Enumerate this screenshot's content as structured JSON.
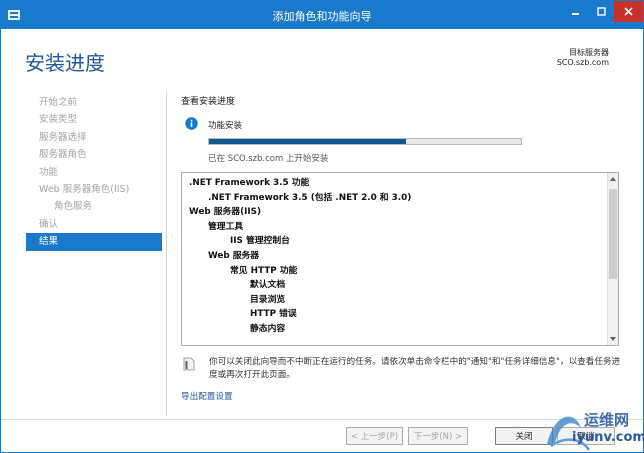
{
  "window": {
    "title": "添加角色和功能向导",
    "controls": {
      "minimize": "▬",
      "maximize": "□",
      "close": "✕"
    }
  },
  "header": {
    "page_title": "安装进度",
    "target_label": "目标服务器",
    "target_server": "SCO.szb.com"
  },
  "nav": {
    "items": [
      {
        "label": "开始之前"
      },
      {
        "label": "安装类型"
      },
      {
        "label": "服务器选择"
      },
      {
        "label": "服务器角色"
      },
      {
        "label": "功能"
      },
      {
        "label": "Web 服务器角色(IIS)"
      },
      {
        "label": "角色服务"
      },
      {
        "label": "确认"
      },
      {
        "label": "结果"
      }
    ],
    "active_index": 8
  },
  "main": {
    "section_label": "查看安装进度",
    "feature_install_label": "功能安装",
    "progress": 0.63,
    "status": "已在 SCO.szb.com 上开始安装",
    "list": [
      {
        "text": ".NET Framework 3.5 功能",
        "level": 0
      },
      {
        "text": ".NET Framework 3.5 (包括 .NET 2.0 和 3.0)",
        "level": 1
      },
      {
        "text": "Web 服务器(IIS)",
        "level": 0
      },
      {
        "text": "管理工具",
        "level": 1
      },
      {
        "text": "IIS 管理控制台",
        "level": 2
      },
      {
        "text": "Web 服务器",
        "level": 1
      },
      {
        "text": "常见 HTTP 功能",
        "level": 2
      },
      {
        "text": "默认文档",
        "level": 3
      },
      {
        "text": "目录浏览",
        "level": 3
      },
      {
        "text": "HTTP 错误",
        "level": 3
      },
      {
        "text": "静态内容",
        "level": 3
      }
    ],
    "note": "你可以关闭此向导而不中断正在运行的任务。请依次单击命令栏中的\"通知\"和\"任务详细信息\"，以查看任务进度或再次打开此页面。",
    "export_link": "导出配置设置"
  },
  "footer": {
    "prev": "< 上一步(P)",
    "next": "下一步(N) >",
    "close": "关闭",
    "cancel": "取消"
  },
  "watermark": {
    "line1": "运维网",
    "line2": "iyunv.com"
  },
  "colors": {
    "accent": "#1979ca",
    "title_text": "#1e5a9c",
    "progress_fill": "#0f5891",
    "close_button": "#c7312b"
  }
}
